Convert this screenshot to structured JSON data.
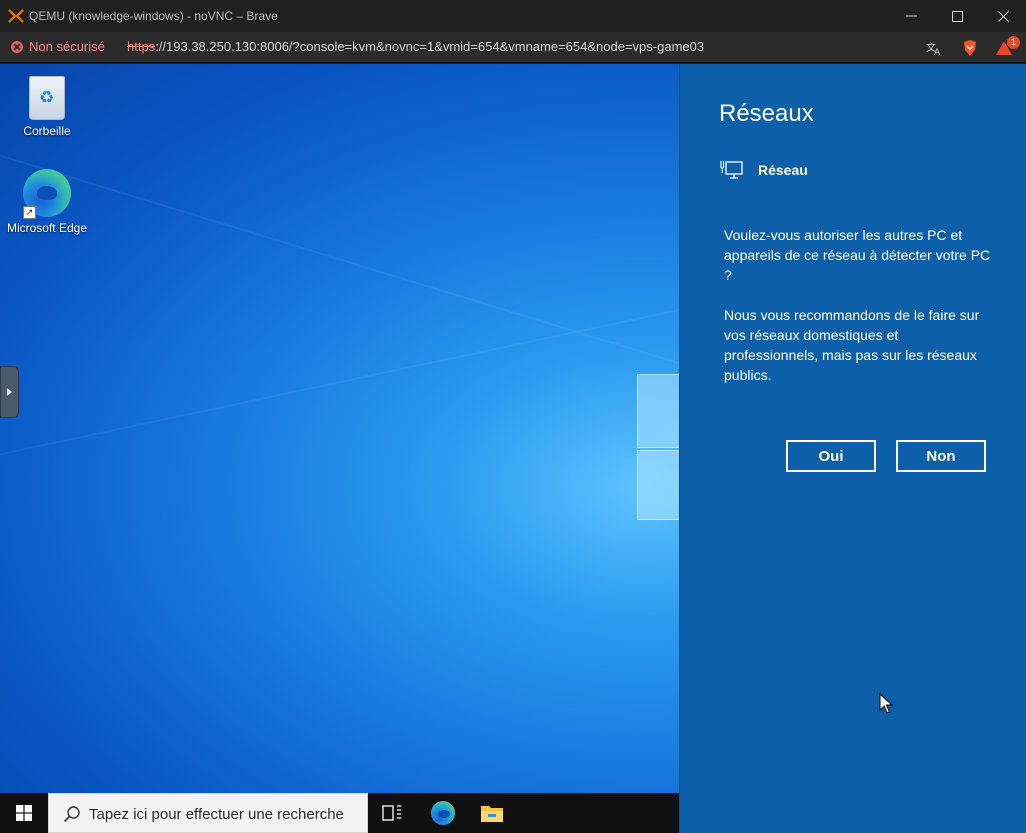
{
  "browser": {
    "window_title": "QEMU (knowledge-windows) - noVNC – Brave",
    "security_label": "Non sécurisé",
    "url_scheme": "https",
    "url_rest": "://193.38.250.130:8006/?console=kvm&novnc=1&vmid=654&vmname=654&node=vps-game03",
    "rewards_badge": "1"
  },
  "desktop": {
    "icons": [
      {
        "label": "Corbeille",
        "icon": "recycle-bin-icon"
      },
      {
        "label": "Microsoft Edge",
        "icon": "edge-icon"
      }
    ]
  },
  "taskbar": {
    "search_placeholder": "Tapez ici pour effectuer une recherche",
    "apps": [
      "task-view-icon",
      "edge-icon",
      "file-explorer-icon"
    ]
  },
  "network_flyout": {
    "title": "Réseaux",
    "network_name": "Réseau",
    "question": "Voulez-vous autoriser les autres PC et appareils de ce réseau à détecter votre PC ?",
    "recommendation": "Nous vous recommandons de le faire sur vos réseaux domestiques et professionnels, mais pas sur les réseaux publics.",
    "yes_label": "Oui",
    "no_label": "Non"
  },
  "colors": {
    "flyout_bg": "#0c5fa8",
    "insecure_red": "#f28b82",
    "desktop_blue": "#1778dd"
  }
}
